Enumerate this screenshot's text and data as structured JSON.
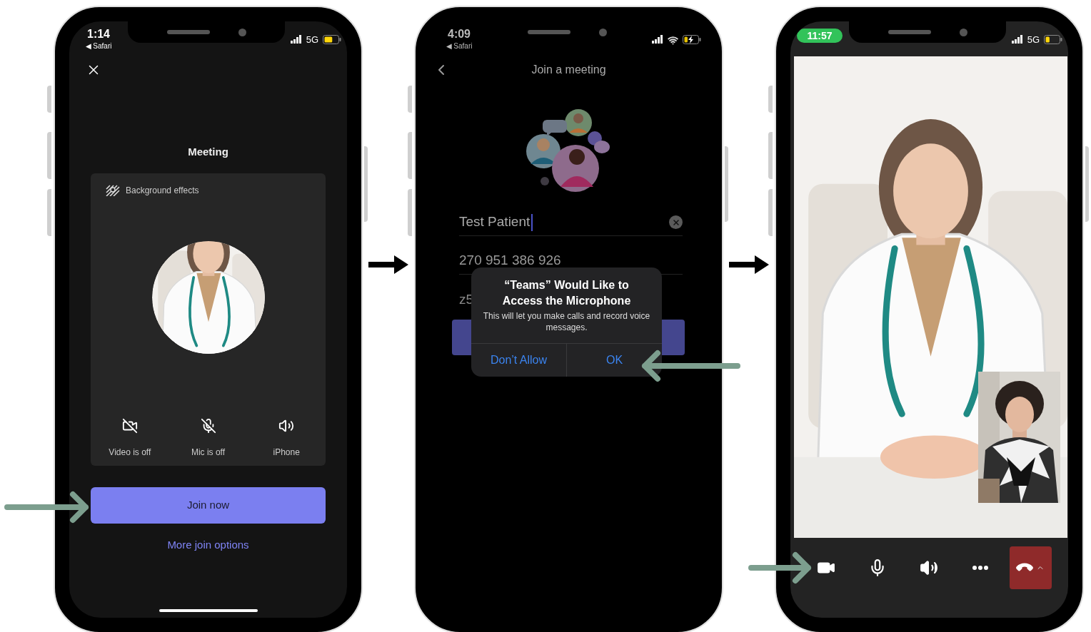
{
  "prejoin_screen": {
    "status_bar": {
      "time": "1:14",
      "back_link": "◀ Safari",
      "network": "5G"
    },
    "title": "Meeting",
    "background_effects": "Background effects",
    "device_toggles": [
      {
        "kind": "video",
        "label": "Video is off",
        "on": false
      },
      {
        "kind": "mic",
        "label": "Mic is off",
        "on": false
      },
      {
        "kind": "speaker",
        "label": "iPhone"
      }
    ],
    "join_button": "Join now",
    "more_options_link": "More join options"
  },
  "join_screen": {
    "status_bar": {
      "time": "4:09",
      "back_link": "◀ Safari"
    },
    "title": "Join a meeting",
    "name_field": {
      "value": "Test Patient"
    },
    "meeting_id_field": {
      "value": "270 951 386 926"
    },
    "passcode_field": {
      "value": "z5"
    },
    "permission_dialog": {
      "title": "“Teams” Would Like to Access the Microphone",
      "message": "This will let you make calls and record voice messages.",
      "buttons": [
        "Don’t Allow",
        "OK"
      ]
    }
  },
  "call_screen": {
    "status_bar": {
      "time": "11:57",
      "network": "5G"
    },
    "call_controls": [
      {
        "kind": "video",
        "on": true
      },
      {
        "kind": "mic",
        "on": true
      },
      {
        "kind": "speaker"
      },
      {
        "kind": "more"
      },
      {
        "kind": "hang_up"
      }
    ]
  }
}
